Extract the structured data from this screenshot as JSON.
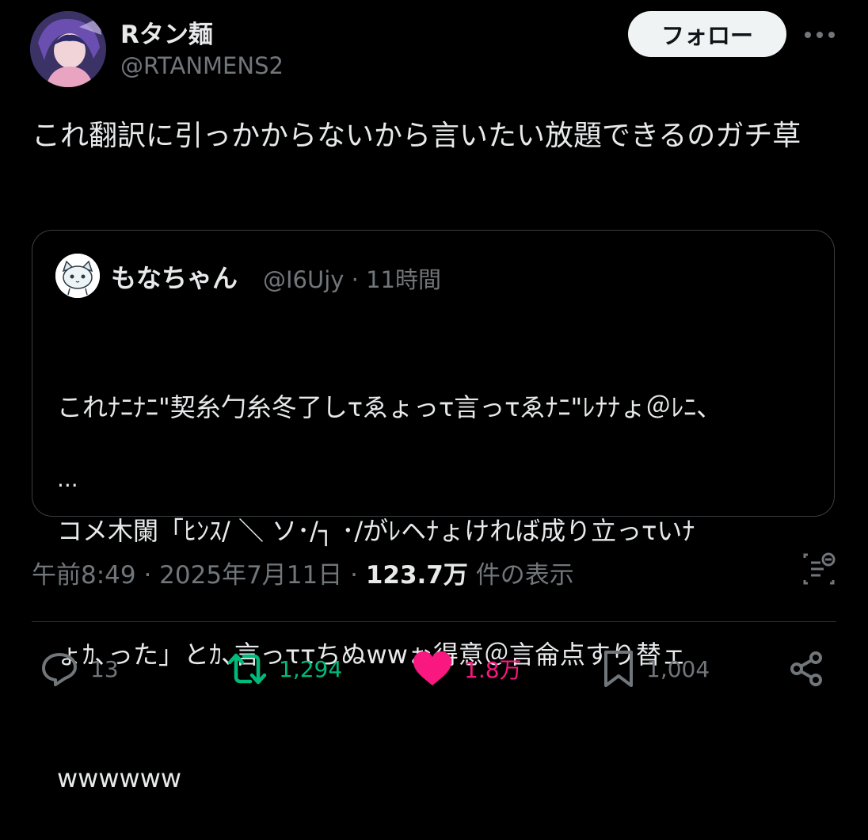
{
  "author": {
    "display_name": "Rタン麺",
    "handle": "@RTANMENS2",
    "avatar_icon": "anime-girl-avatar"
  },
  "follow_label": "フォロー",
  "more_icon": "more-horizontal-icon",
  "tweet": {
    "text": "これ翻訳に引っかからないから言いたい放題できるのガチ草"
  },
  "quote": {
    "display_name": "もなちゃん",
    "meta": "@I6Ujy · 11時間",
    "avatar_icon": "cat-avatar",
    "lines": [
      "これﾅﾆﾅﾆ\"契糸勹糸冬了しτゑょっτ言っτゑﾅﾆ\"ﾚﾅﾅょ＠ﾚﾆ、",
      "コメ木闌「ﾋﾝｽ/ ＼ ソ･/┐ ･/がﾚヘﾅょければ成り立っτいﾅ",
      "ょｶ､った」とｶ､言っττちぬwwぉ得意＠言侖点すり替ェ",
      "wwwwww"
    ],
    "ellipsis": "..."
  },
  "meta": {
    "time_date": "午前8:49 · 2025年7月11日 · ",
    "views_count": "123.7万",
    "views_label": " 件の表示"
  },
  "actions": {
    "reply_count": "13",
    "retweet_count": "1,294",
    "like_count": "1.8万",
    "bookmark_count": "1,004"
  },
  "colors": {
    "background": "#000000",
    "text_primary": "#e7e9ea",
    "text_secondary": "#71767b",
    "retweet_active": "#00ba7c",
    "like_active": "#f91880",
    "follow_button_bg": "#eff3f4",
    "border": "#2f3336"
  }
}
